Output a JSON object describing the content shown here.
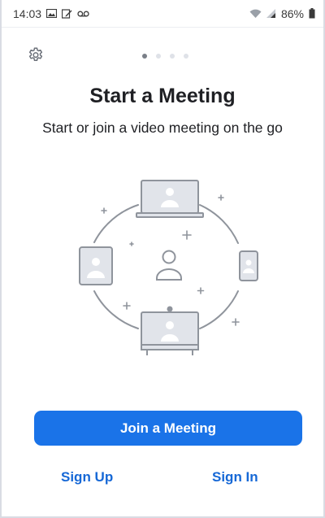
{
  "status_bar": {
    "time": "14:03",
    "battery": "86%",
    "left_icons": [
      "image-icon",
      "edit-icon",
      "voicemail-icon"
    ],
    "right_icons": [
      "wifi-icon",
      "signal-icon",
      "battery-icon"
    ]
  },
  "header": {
    "settings_icon": "gear-icon",
    "pager_total": 4,
    "pager_active": 1
  },
  "onboarding": {
    "title": "Start a Meeting",
    "subtitle": "Start or join a video meeting on the go"
  },
  "actions": {
    "join_label": "Join a Meeting",
    "sign_up_label": "Sign Up",
    "sign_in_label": "Sign In"
  },
  "colors": {
    "primary": "#1a73e8",
    "link": "#1668d6",
    "illustration_stroke": "#8f949c",
    "illustration_fill": "#e1e4ea"
  }
}
